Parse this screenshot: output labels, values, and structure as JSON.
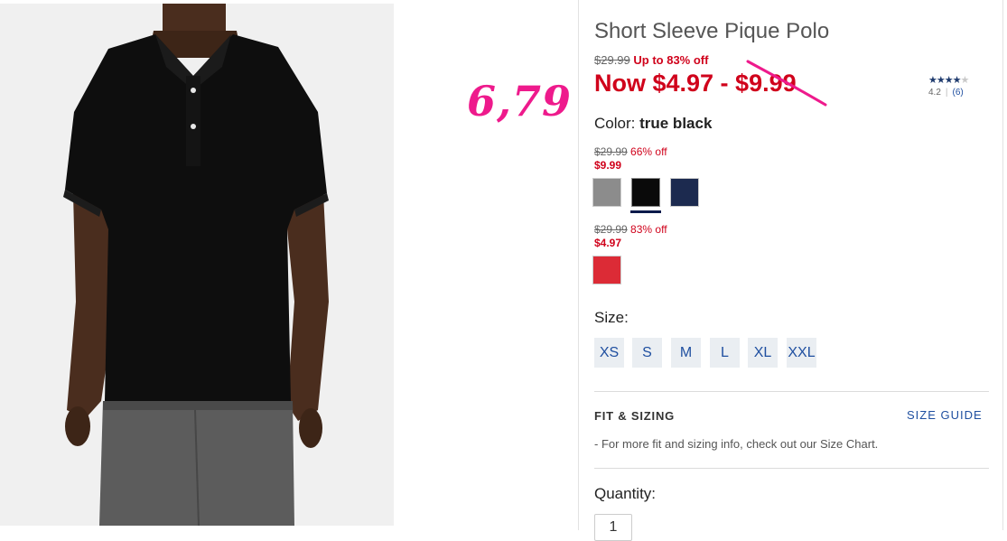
{
  "product": {
    "title": "Short Sleeve Pique Polo",
    "original_price": "$29.99",
    "promo": "Up to 83% off",
    "now_price": "Now $4.97 - $9.99",
    "rating_value": "4.2",
    "rating_count": "(6)",
    "stars_filled": 4,
    "image_name": "black-polo-model-photo"
  },
  "annotation": {
    "note": "6,79",
    "color": "#ee1a8c"
  },
  "color": {
    "label": "Color:",
    "value": "true black",
    "groups": [
      {
        "original": "$29.99",
        "discount": "66% off",
        "sale": "$9.99",
        "swatches": [
          {
            "name": "heather-gray",
            "hex": "#8c8c8c"
          },
          {
            "name": "true-black",
            "hex": "#0a0a0a",
            "selected": true
          },
          {
            "name": "navy",
            "hex": "#1c2a4f"
          }
        ]
      },
      {
        "original": "$29.99",
        "discount": "83% off",
        "sale": "$4.97",
        "swatches": [
          {
            "name": "red",
            "hex": "#dc2b36"
          }
        ]
      }
    ]
  },
  "size": {
    "label": "Size:",
    "options": [
      "XS",
      "S",
      "M",
      "L",
      "XL",
      "XXL"
    ]
  },
  "fit": {
    "title": "FIT & SIZING",
    "guide_link": "SIZE GUIDE",
    "text": "- For more fit and sizing info, check out our Size Chart."
  },
  "quantity": {
    "label": "Quantity:",
    "value": "1"
  },
  "colors": {
    "sale_red": "#d0021b",
    "link_blue": "#1f4fa0",
    "size_bg": "#eaeef2"
  }
}
